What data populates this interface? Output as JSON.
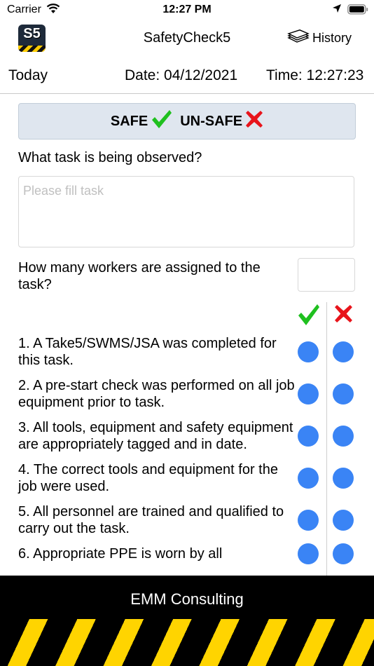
{
  "status_bar": {
    "carrier": "Carrier",
    "time": "12:27 PM"
  },
  "navbar": {
    "logo_text": "S5",
    "title": "SafetyCheck5",
    "history_label": "History"
  },
  "date_row": {
    "today": "Today",
    "date": "Date: 04/12/2021",
    "time": "Time: 12:27:23"
  },
  "legend": {
    "safe_label": "SAFE",
    "unsafe_label": "UN-SAFE"
  },
  "task": {
    "label": "What task is being observed?",
    "placeholder": "Please fill task",
    "value": ""
  },
  "workers": {
    "label": "How many workers are assigned to the task?",
    "value": ""
  },
  "questions": [
    "1. A Take5/SWMS/JSA was completed for this task.",
    "2. A pre-start check was performed on all job equipment prior to task.",
    "3. All tools, equipment and safety equipment are appropriately tagged and in date.",
    "4. The correct tools and equipment for the job were used.",
    "5. All personnel are trained and qualified to carry out the task.",
    "6. Appropriate PPE is worn by all"
  ],
  "footer": {
    "company": "EMM Consulting"
  },
  "colors": {
    "accent_blue": "#3a84f5",
    "safe_green": "#1fc01f",
    "unsafe_red": "#e8141b",
    "hazard_yellow": "#ffd400"
  }
}
